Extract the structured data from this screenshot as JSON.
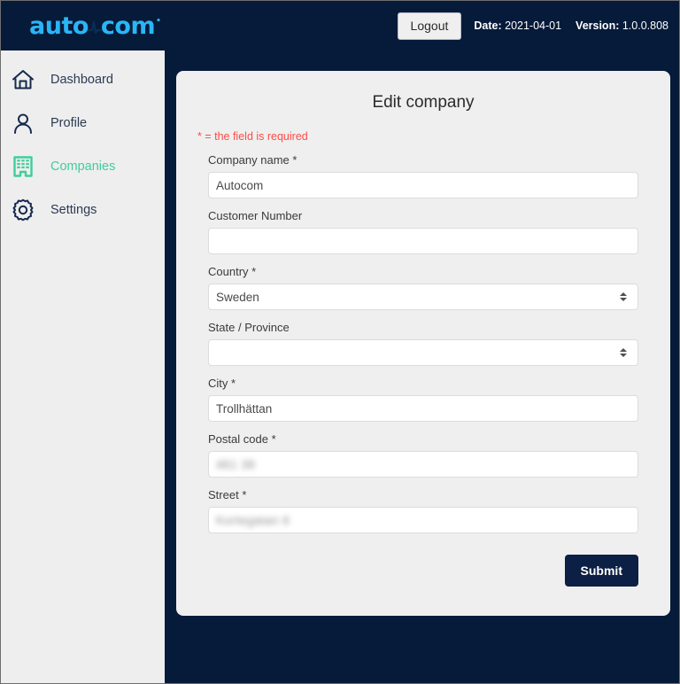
{
  "header": {
    "logo": {
      "part1": "auto",
      "icon": "pulse-wave-icon",
      "part2": "com",
      "trademark": "•"
    },
    "logout_label": "Logout",
    "date_label": "Date:",
    "date_value": "2021-04-01",
    "version_label": "Version:",
    "version_value": "1.0.0.808",
    "background_color": "#061a3a",
    "logo_color": "#29b6f6"
  },
  "sidebar": {
    "background_color": "#eeeeee",
    "active_color": "#3ecf9a",
    "items": [
      {
        "label": "Dashboard",
        "icon": "home-icon",
        "active": false
      },
      {
        "label": "Profile",
        "icon": "user-icon",
        "active": false
      },
      {
        "label": "Companies",
        "icon": "building-icon",
        "active": true
      },
      {
        "label": "Settings",
        "icon": "gear-icon",
        "active": false
      }
    ]
  },
  "main": {
    "card_title": "Edit company",
    "required_note": "* = the field is required",
    "required_note_color": "#ff4b47",
    "fields": [
      {
        "label": "Company name",
        "required": true,
        "type": "text",
        "value": "Autocom",
        "blurred": false
      },
      {
        "label": "Customer Number",
        "required": false,
        "type": "text",
        "value": "",
        "blurred": false
      },
      {
        "label": "Country",
        "required": true,
        "type": "select",
        "value": "Sweden",
        "blurred": false
      },
      {
        "label": "State / Province",
        "required": false,
        "type": "select",
        "value": "",
        "blurred": false
      },
      {
        "label": "City",
        "required": true,
        "type": "text",
        "value": "Trollhättan",
        "blurred": false
      },
      {
        "label": "Postal code",
        "required": true,
        "type": "text",
        "value": "461 38",
        "blurred": true
      },
      {
        "label": "Street",
        "required": true,
        "type": "text",
        "value": "Kortegatan 6",
        "blurred": true
      }
    ],
    "submit_label": "Submit",
    "submit_color": "#0c1f44"
  }
}
